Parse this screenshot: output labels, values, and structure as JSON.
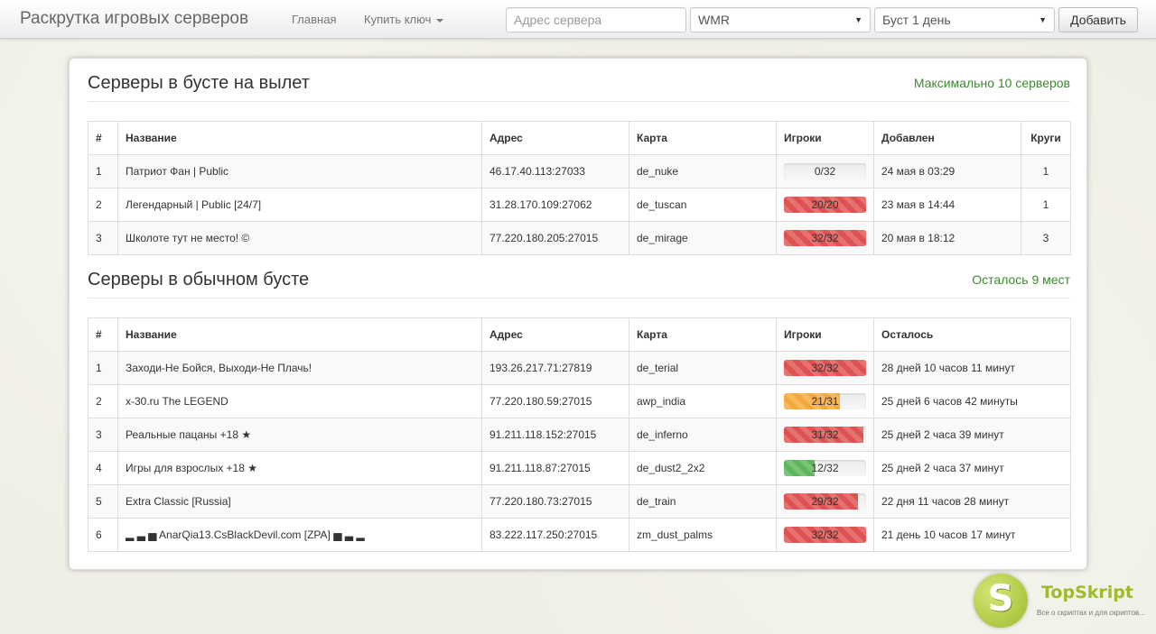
{
  "navbar": {
    "brand": "Раскрутка игровых серверов",
    "home_label": "Главная",
    "buy_key_label": "Купить ключ",
    "address_placeholder": "Адрес сервера",
    "payment_selected": "WMR",
    "boost_selected": "Буст 1 день",
    "add_label": "Добавить"
  },
  "boost_section": {
    "title": "Серверы в бусте на вылет",
    "note": "Максимально 10 серверов",
    "columns": [
      "#",
      "Название",
      "Адрес",
      "Карта",
      "Игроки",
      "Добавлен",
      "Круги"
    ],
    "rows": [
      {
        "num": "1",
        "name": "Патриот Фан | Public",
        "address": "46.17.40.113:27033",
        "map": "de_nuke",
        "players_text": "0/32",
        "players_fraction": 0.0,
        "bar": "danger",
        "added": "24 мая в 03:29",
        "rounds": "1"
      },
      {
        "num": "2",
        "name": "Легендарный | Public [24/7]",
        "address": "31.28.170.109:27062",
        "map": "de_tuscan",
        "players_text": "20/20",
        "players_fraction": 1.0,
        "bar": "danger",
        "added": "23 мая в 14:44",
        "rounds": "1"
      },
      {
        "num": "3",
        "name": "Школоте тут не место! ©",
        "address": "77.220.180.205:27015",
        "map": "de_mirage",
        "players_text": "32/32",
        "players_fraction": 1.0,
        "bar": "danger",
        "added": "20 мая в 18:12",
        "rounds": "3"
      }
    ]
  },
  "regular_section": {
    "title": "Серверы в обычном бусте",
    "note": "Осталось 9 мест",
    "columns": [
      "#",
      "Название",
      "Адрес",
      "Карта",
      "Игроки",
      "Осталось"
    ],
    "rows": [
      {
        "num": "1",
        "name": "Заходи-Не Бойся, Выходи-Не Плачь!",
        "address": "193.26.217.71:27819",
        "map": "de_terial",
        "players_text": "32/32",
        "players_fraction": 1.0,
        "bar": "danger",
        "remaining": "28 дней 10 часов 11 минут"
      },
      {
        "num": "2",
        "name": "x-30.ru The LEGEND",
        "address": "77.220.180.59:27015",
        "map": "awp_india",
        "players_text": "21/31",
        "players_fraction": 0.677,
        "bar": "warning",
        "remaining": "25 дней 6 часов 42 минуты"
      },
      {
        "num": "3",
        "name": "Реальные пацаны +18 ★",
        "address": "91.211.118.152:27015",
        "map": "de_inferno",
        "players_text": "31/32",
        "players_fraction": 0.969,
        "bar": "danger",
        "remaining": "25 дней 2 часа 39 минут"
      },
      {
        "num": "4",
        "name": "Игры для взрослых +18 ★",
        "address": "91.211.118.87:27015",
        "map": "de_dust2_2x2",
        "players_text": "12/32",
        "players_fraction": 0.375,
        "bar": "success",
        "remaining": "25 дней 2 часа 37 минут"
      },
      {
        "num": "5",
        "name": "Extra Classic [Russia]",
        "address": "77.220.180.73:27015",
        "map": "de_train",
        "players_text": "29/32",
        "players_fraction": 0.906,
        "bar": "danger",
        "remaining": "22 дня 11 часов 28 минут"
      },
      {
        "num": "6",
        "name": "▂ ▃ ▅ AnarQia13.CsBlackDevil.com [ZPA] ▅ ▃ ▂",
        "address": "83.222.117.250:27015",
        "map": "zm_dust_palms",
        "players_text": "32/32",
        "players_fraction": 1.0,
        "bar": "danger",
        "remaining": "21 день 10 часов 17 минут"
      }
    ]
  },
  "watermark": {
    "logo_letter": "S",
    "name": "TopSkript",
    "tagline": "Все о скриптах и для скриптов..."
  }
}
